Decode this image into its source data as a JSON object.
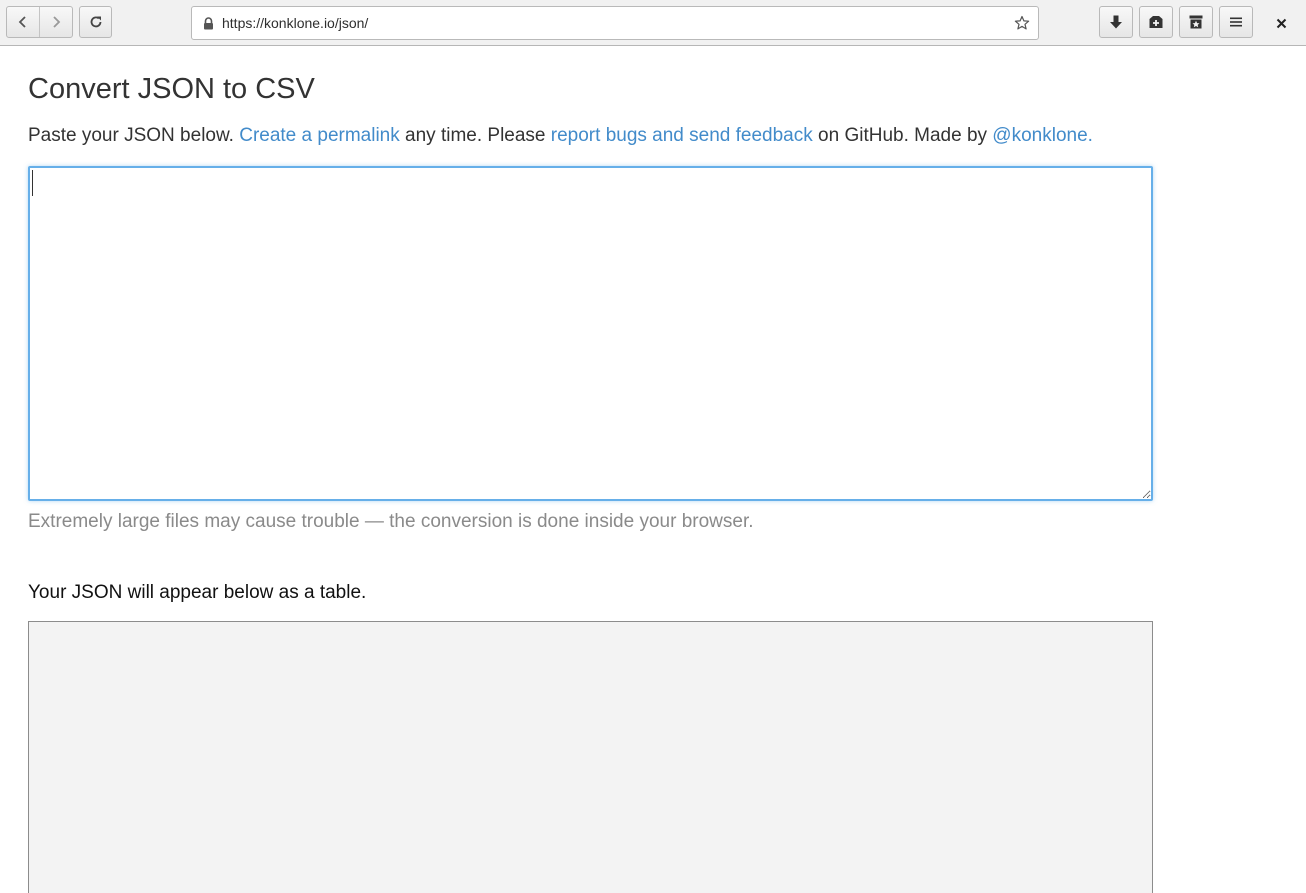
{
  "browser": {
    "url": "https://konklone.io/json/",
    "icons": {
      "back": "chevron-left-icon",
      "forward": "chevron-right-icon",
      "reload": "reload-icon",
      "lock": "lock-icon",
      "bookmark": "star-icon",
      "downloads": "download-icon",
      "new_tab": "new-tab-icon",
      "bookmarks_menu": "bookmarks-icon",
      "menu": "hamburger-menu-icon",
      "close": "close-icon"
    }
  },
  "page": {
    "title": "Convert JSON to CSV",
    "intro": {
      "part1": "Paste your JSON below. ",
      "permalink_link": "Create a permalink",
      "part2": " any time. Please ",
      "feedback_link": "report bugs and send feedback",
      "part3": " on GitHub. Made by ",
      "author_link": "@konklone."
    },
    "json_input": {
      "value": "",
      "placeholder": ""
    },
    "hint": "Extremely large files may cause trouble — the conversion is done inside your browser.",
    "table_caption": "Your JSON will appear below as a table."
  },
  "colors": {
    "link": "#428bca",
    "focus_border": "#66afe9",
    "hint_text": "#8a8a8a",
    "table_bg": "#f3f3f3"
  }
}
